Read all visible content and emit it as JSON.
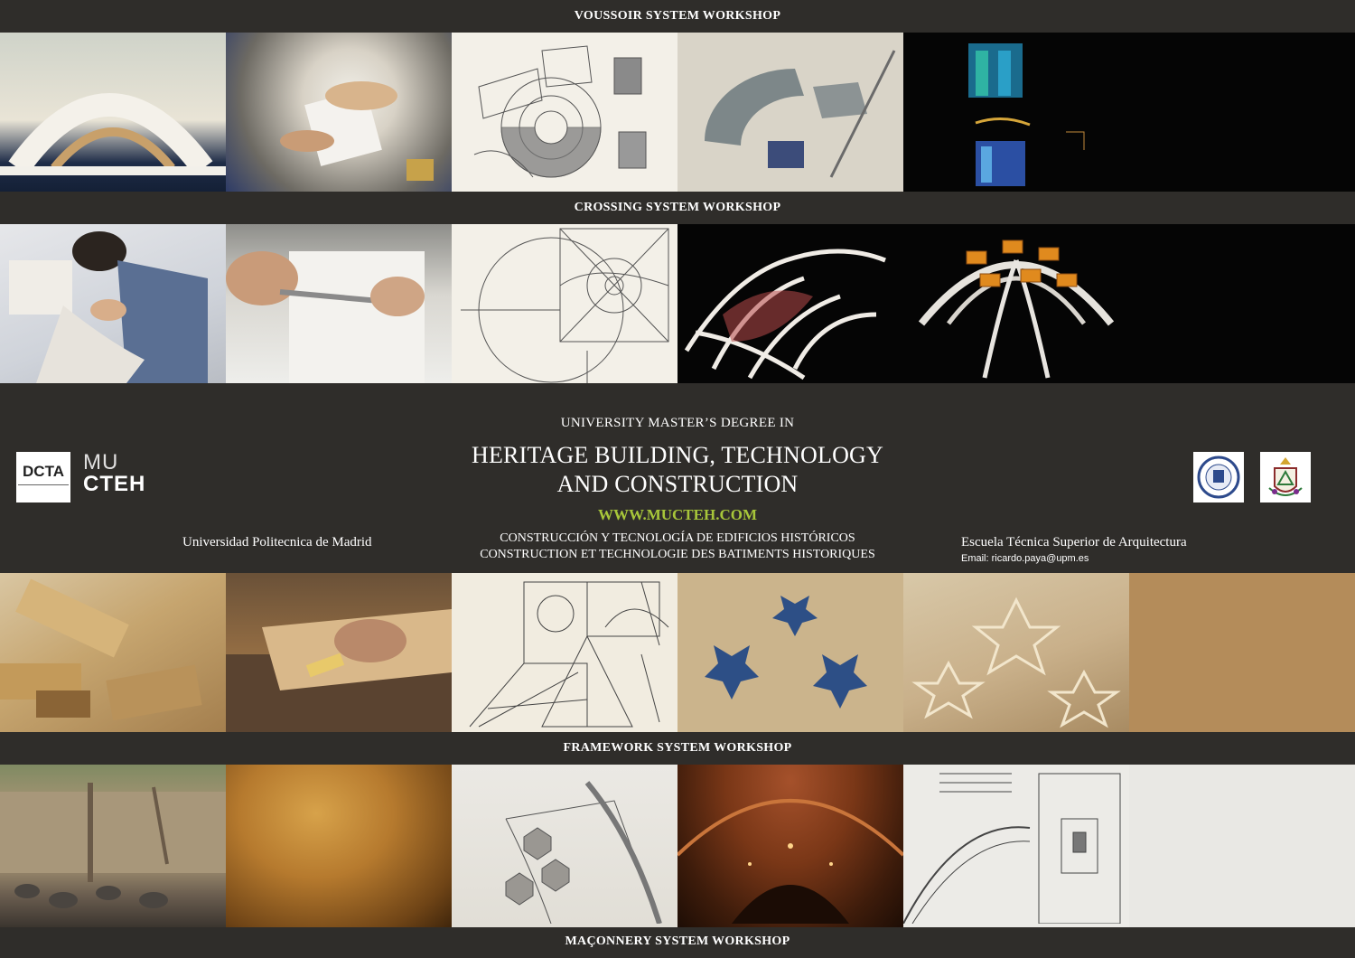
{
  "bands": {
    "voussoir": "VOUSSOIR SYSTEM WORKSHOP",
    "crossing": "CROSSING SYSTEM WORKSHOP",
    "framework": "FRAMEWORK SYSTEM WORKSHOP",
    "maconnery": "MAÇONNERY SYSTEM WORKSHOP"
  },
  "center": {
    "subtitle": "UNIVERSITY MASTER’S DEGREE IN",
    "title_line1": "HERITAGE BUILDING, TECHNOLOGY",
    "title_line2": "AND CONSTRUCTION",
    "website": "WWW.MUCTEH.COM",
    "spanish": "CONSTRUCCIÓN Y TECNOLOGÍA DE EDIFICIOS HISTÓRICOS",
    "french": "CONSTRUCTION ET TECHNOLOGIE DES BATIMENTS HISTORIQUES",
    "left_institution": "Universidad Politecnica de Madrid",
    "right_institution": "Escuela Técnica Superior de Arquitectura",
    "email": "Email: ricardo.paya@upm.es"
  },
  "logos": {
    "dcta": "DCTA",
    "mucteh_top": "MU",
    "mucteh_bottom": "CTEH"
  },
  "colors": {
    "background": "#2f2d2a",
    "accent_green": "#a7c63a",
    "text": "#ffffff"
  }
}
